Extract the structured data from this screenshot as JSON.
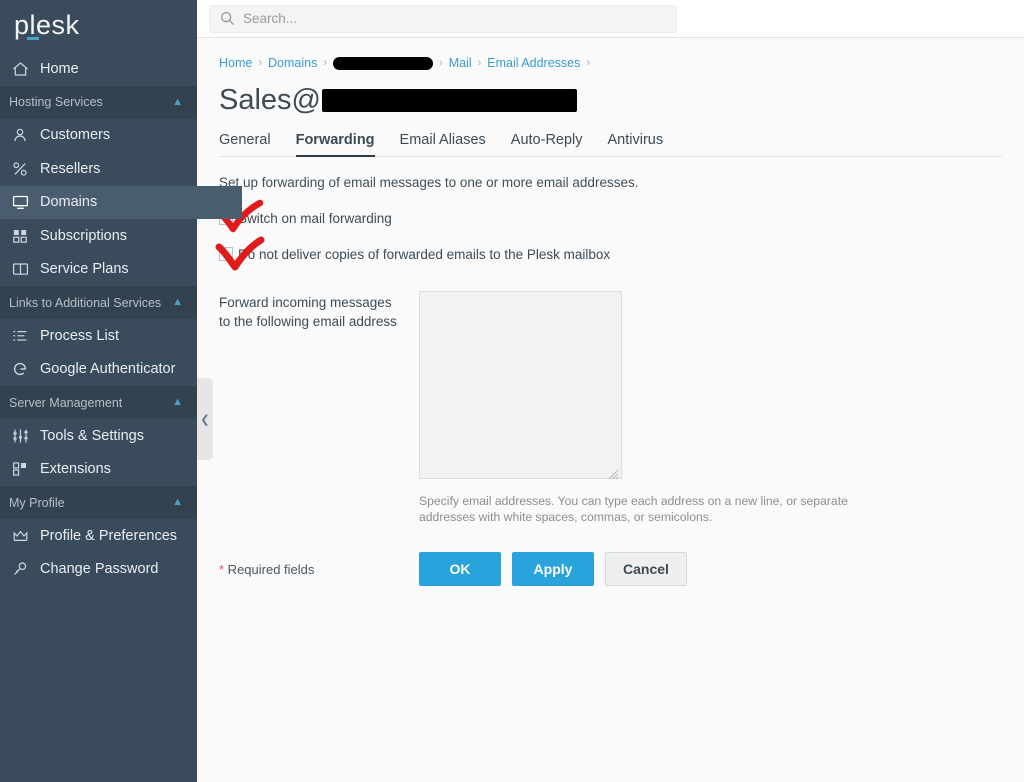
{
  "brand": {
    "logo_text": "plesk",
    "accent": "#4aa3c7"
  },
  "search": {
    "placeholder": "Search...",
    "value": "",
    "icon": "search-icon"
  },
  "sidebar": {
    "background": "#3a4b5c",
    "active_item_background": "#4a5d6e",
    "collapse_handle_icon": "chevron-left-icon",
    "items": [
      {
        "type": "item",
        "label": "Home",
        "icon": "home-icon",
        "active": false
      },
      {
        "type": "section",
        "label": "Hosting Services",
        "icon": "chevron-up-icon"
      },
      {
        "type": "item",
        "label": "Customers",
        "icon": "user-icon",
        "active": false
      },
      {
        "type": "item",
        "label": "Resellers",
        "icon": "percent-icon",
        "active": false
      },
      {
        "type": "item",
        "label": "Domains",
        "icon": "monitor-icon",
        "active": true
      },
      {
        "type": "item",
        "label": "Subscriptions",
        "icon": "grid-icon",
        "active": false
      },
      {
        "type": "item",
        "label": "Service Plans",
        "icon": "book-icon",
        "active": false
      },
      {
        "type": "section",
        "label": "Links to Additional Services",
        "icon": "chevron-up-icon"
      },
      {
        "type": "item",
        "label": "Process List",
        "icon": "list-icon",
        "active": false
      },
      {
        "type": "item",
        "label": "Google Authenticator",
        "icon": "google-g-icon",
        "active": false
      },
      {
        "type": "section",
        "label": "Server Management",
        "icon": "chevron-up-icon"
      },
      {
        "type": "item",
        "label": "Tools & Settings",
        "icon": "sliders-icon",
        "active": false
      },
      {
        "type": "item",
        "label": "Extensions",
        "icon": "extensions-icon",
        "active": false
      },
      {
        "type": "section",
        "label": "My Profile",
        "icon": "chevron-up-icon"
      },
      {
        "type": "item",
        "label": "Profile & Preferences",
        "icon": "crown-icon",
        "active": false
      },
      {
        "type": "item",
        "label": "Change Password",
        "icon": "key-icon",
        "active": false
      }
    ]
  },
  "breadcrumb": {
    "separator": "›",
    "items": [
      {
        "label": "Home",
        "redacted": false
      },
      {
        "label": "Domains",
        "redacted": false
      },
      {
        "label": "",
        "redacted": true
      },
      {
        "label": "Mail",
        "redacted": false
      },
      {
        "label": "Email Addresses",
        "redacted": false
      }
    ],
    "trailing_separator": true
  },
  "page": {
    "title_prefix": "Sales@",
    "title_redacted": true
  },
  "tabs": [
    {
      "label": "General",
      "active": false
    },
    {
      "label": "Forwarding",
      "active": true
    },
    {
      "label": "Email Aliases",
      "active": false
    },
    {
      "label": "Auto-Reply",
      "active": false
    },
    {
      "label": "Antivirus",
      "active": false
    }
  ],
  "form": {
    "intro": "Set up forwarding of email messages to one or more email addresses.",
    "checkboxes": [
      {
        "label": "Switch on mail forwarding",
        "checked": false,
        "annotated_red_check": true
      },
      {
        "label": "Do not deliver copies of forwarded emails to the Plesk mailbox",
        "checked": false,
        "annotated_red_check": true
      }
    ],
    "forward_field": {
      "label_line1": "Forward incoming messages",
      "label_line2": "to the following email address",
      "value": "",
      "hint": "Specify email addresses. You can type each address on a new line, or separate addresses with white spaces, commas, or semicolons."
    },
    "required_note": {
      "star": "*",
      "text": " Required fields"
    },
    "buttons": [
      {
        "label": "OK",
        "style": "primary"
      },
      {
        "label": "Apply",
        "style": "primary"
      },
      {
        "label": "Cancel",
        "style": "secondary"
      }
    ]
  },
  "annotation": {
    "color": "#e01b1b",
    "type": "hand-drawn-red-checkmarks",
    "count": 2
  }
}
